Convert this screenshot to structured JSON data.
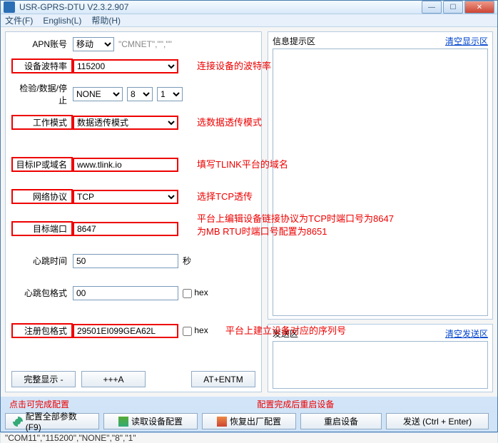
{
  "title": "USR-GPRS-DTU V2.3.2.907",
  "menu": {
    "file": "文件(F)",
    "english": "English(L)",
    "help": "帮助(H)"
  },
  "fields": {
    "apn": {
      "label": "APN账号",
      "value": "移动",
      "extra": "\"CMNET\",\"\",\"\""
    },
    "baud": {
      "label": "设备波特率",
      "value": "115200",
      "note": "连接设备的波特率"
    },
    "check": {
      "label": "检验/数据/停止",
      "v1": "NONE",
      "v2": "8",
      "v3": "1"
    },
    "mode": {
      "label": "工作模式",
      "value": "数据透传模式",
      "note": "选数据透传模式"
    },
    "ip": {
      "label": "目标IP或域名",
      "value": "www.tlink.io",
      "note": "填写TLINK平台的域名"
    },
    "proto": {
      "label": "网络协议",
      "value": "TCP",
      "note": "选择TCP透传"
    },
    "port": {
      "label": "目标端口",
      "value": "8647",
      "note1": "平台上编辑设备链接协议为TCP时端口号为8647",
      "note2": "为MB RTU时端口号配置为8651"
    },
    "hb": {
      "label": "心跳时间",
      "value": "50",
      "unit": "秒"
    },
    "hbpkt": {
      "label": "心跳包格式",
      "value": "00",
      "hex": "hex"
    },
    "reg": {
      "label": "注册包格式",
      "value": "29501EI099GEA62L",
      "hex": "hex",
      "note": "平台上建立设备对应的序列号"
    }
  },
  "btns": {
    "showall": "完整显示 -",
    "plusa": "+++A",
    "atentm": "AT+ENTM",
    "cfgall": "配置全部参数(F9)",
    "readcfg": "读取设备配置",
    "restore": "恢复出厂配置",
    "reboot": "重启设备",
    "send": "发送 (Ctrl + Enter)"
  },
  "notes": {
    "click": "点击可完成配置",
    "after": "配置完成后重启设备"
  },
  "right": {
    "info": "信息提示区",
    "clearinfo": "清空显示区",
    "send": "发送区",
    "clearsend": "清空发送区"
  },
  "status": "\"COM11\",\"115200\",\"NONE\",\"8\",\"1\""
}
